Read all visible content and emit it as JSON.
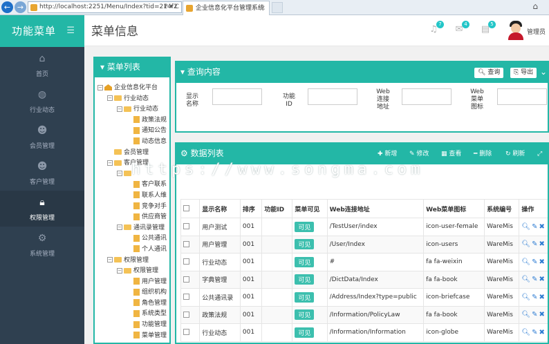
{
  "browser": {
    "url": "http://localhost:2251/Menu/Index?tid=214f2",
    "url_actions": "P ▾ C",
    "tab_title": "企业信息化平台管理系统",
    "tab_close": "×"
  },
  "sidebar": {
    "title": "功能菜单",
    "items": [
      {
        "label": "首页",
        "icon": "home-icon"
      },
      {
        "label": "行业动态",
        "icon": "globe-icon"
      },
      {
        "label": "会员管理",
        "icon": "users-icon"
      },
      {
        "label": "客户管理",
        "icon": "customers-icon"
      },
      {
        "label": "权限管理",
        "icon": "lock-icon",
        "active": true
      },
      {
        "label": "系统管理",
        "icon": "gear-icon"
      }
    ]
  },
  "topbar": {
    "title": "菜单信息",
    "badges": {
      "bell": "7",
      "mail": "4",
      "tasks": "5"
    },
    "user": "管理员"
  },
  "tree": {
    "title": "菜单列表",
    "nodes": [
      {
        "label": "企业信息化平台",
        "type": "home",
        "level": 0,
        "toggle": "-"
      },
      {
        "label": "行业动态",
        "type": "folder",
        "level": 1,
        "toggle": "-"
      },
      {
        "label": "行业动态",
        "type": "folder",
        "level": 2,
        "toggle": "-"
      },
      {
        "label": "政策法规",
        "type": "file",
        "level": 3,
        "toggle": ""
      },
      {
        "label": "通知公告",
        "type": "file",
        "level": 3,
        "toggle": ""
      },
      {
        "label": "动态信息",
        "type": "file",
        "level": 3,
        "toggle": ""
      },
      {
        "label": "会员管理",
        "type": "folder",
        "level": 1,
        "toggle": ""
      },
      {
        "label": "客户管理",
        "type": "folder",
        "level": 1,
        "toggle": "-"
      },
      {
        "label": "",
        "type": "folder",
        "level": 2,
        "toggle": "-"
      },
      {
        "label": "客户联系",
        "type": "file",
        "level": 3,
        "toggle": ""
      },
      {
        "label": "联系人维",
        "type": "file",
        "level": 3,
        "toggle": ""
      },
      {
        "label": "竞争对手",
        "type": "file",
        "level": 3,
        "toggle": ""
      },
      {
        "label": "供应商管",
        "type": "file",
        "level": 3,
        "toggle": ""
      },
      {
        "label": "通讯录管理",
        "type": "folder",
        "level": 2,
        "toggle": "-"
      },
      {
        "label": "公共通讯",
        "type": "file",
        "level": 3,
        "toggle": ""
      },
      {
        "label": "个人通讯",
        "type": "file",
        "level": 3,
        "toggle": ""
      },
      {
        "label": "权限管理",
        "type": "folder",
        "level": 1,
        "toggle": "-"
      },
      {
        "label": "权限管理",
        "type": "folder",
        "level": 2,
        "toggle": "-"
      },
      {
        "label": "用户管理",
        "type": "file",
        "level": 3,
        "toggle": ""
      },
      {
        "label": "组织机构",
        "type": "file",
        "level": 3,
        "toggle": ""
      },
      {
        "label": "角色管理",
        "type": "file",
        "level": 3,
        "toggle": ""
      },
      {
        "label": "系统类型",
        "type": "file",
        "level": 3,
        "toggle": ""
      },
      {
        "label": "功能管理",
        "type": "file",
        "level": 3,
        "toggle": ""
      },
      {
        "label": "菜单管理",
        "type": "file",
        "level": 3,
        "toggle": ""
      }
    ]
  },
  "query": {
    "title": "查询内容",
    "search_label": "查询",
    "export_label": "导出",
    "fields": [
      {
        "label": "显示\n名称",
        "value": ""
      },
      {
        "label": "功能\nID",
        "value": ""
      },
      {
        "label": "Web\n连接\n地址",
        "value": ""
      },
      {
        "label": "Web\n菜单\n图标",
        "value": ""
      }
    ]
  },
  "data_list": {
    "title": "数据列表",
    "toolbar": {
      "add": "新增",
      "edit": "修改",
      "view": "查看",
      "delete": "删除",
      "refresh": "刷新"
    },
    "columns": [
      "显示名称",
      "排序",
      "功能ID",
      "菜单可见",
      "Web连接地址",
      "Web菜单图标",
      "系统编号",
      "操作"
    ],
    "rows": [
      {
        "name": "用户测试",
        "sort": "001",
        "func_id": "",
        "visible": "可见",
        "url": "/TestUser/index",
        "icon": "icon-user-female",
        "sys": "WareMis"
      },
      {
        "name": "用户管理",
        "sort": "001",
        "func_id": "",
        "visible": "可见",
        "url": "/User/Index",
        "icon": "icon-users",
        "sys": "WareMis"
      },
      {
        "name": "行业动态",
        "sort": "001",
        "func_id": "",
        "visible": "可见",
        "url": "#",
        "icon": "fa fa-weixin",
        "sys": "WareMis"
      },
      {
        "name": "字典管理",
        "sort": "001",
        "func_id": "",
        "visible": "可见",
        "url": "/DictData/Index",
        "icon": "fa fa-book",
        "sys": "WareMis"
      },
      {
        "name": "公共通讯录",
        "sort": "001",
        "func_id": "",
        "visible": "可见",
        "url": "/Address/Index?type=public",
        "icon": "icon-briefcase",
        "sys": "WareMis"
      },
      {
        "name": "政策法规",
        "sort": "001",
        "func_id": "",
        "visible": "可见",
        "url": "/Information/PolicyLaw",
        "icon": "fa fa-book",
        "sys": "WareMis"
      },
      {
        "name": "行业动态",
        "sort": "001",
        "func_id": "",
        "visible": "可见",
        "url": "/Information/Information",
        "icon": "icon-globe",
        "sys": "WareMis"
      }
    ]
  },
  "watermark": "https://www.songma.com",
  "colors": {
    "accent": "#23b7a6",
    "sidebar": "#2f4050",
    "link": "#2d7cd3"
  }
}
